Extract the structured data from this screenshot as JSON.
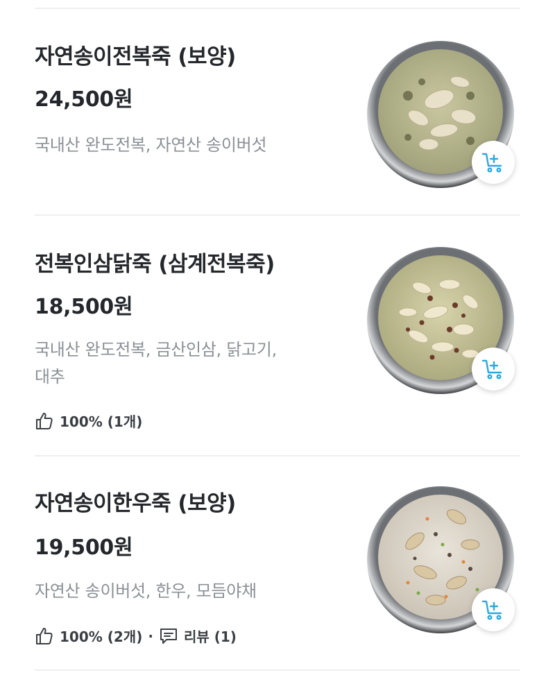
{
  "items": [
    {
      "name": "자연송이전복죽 (보양)",
      "price": "24,500원",
      "description": "국내산 완도전복, 자연산 송이버섯",
      "image_icon": "abalone-porridge-bowl",
      "cart_icon": "add-to-cart-icon"
    },
    {
      "name": "전복인삼닭죽 (삼계전복죽)",
      "price": "18,500원",
      "description_lines": [
        "국내산 완도전복, 금산인삼, 닭고기,",
        "대추"
      ],
      "like_text": "100% (1개)",
      "image_icon": "ginseng-chicken-porridge-bowl",
      "cart_icon": "add-to-cart-icon"
    },
    {
      "name": "자연송이한우죽 (보양)",
      "price": "19,500원",
      "description": "자연산 송이버섯, 한우, 모듬야채",
      "like_text": "100% (2개)",
      "separator": "·",
      "review_text": "리뷰 (1)",
      "image_icon": "beef-mushroom-porridge-bowl",
      "cart_icon": "add-to-cart-icon"
    }
  ],
  "colors": {
    "text_primary": "#24272b",
    "text_secondary": "#8a9096",
    "accent_cart": "#29a9e0",
    "divider": "#eceef0"
  }
}
